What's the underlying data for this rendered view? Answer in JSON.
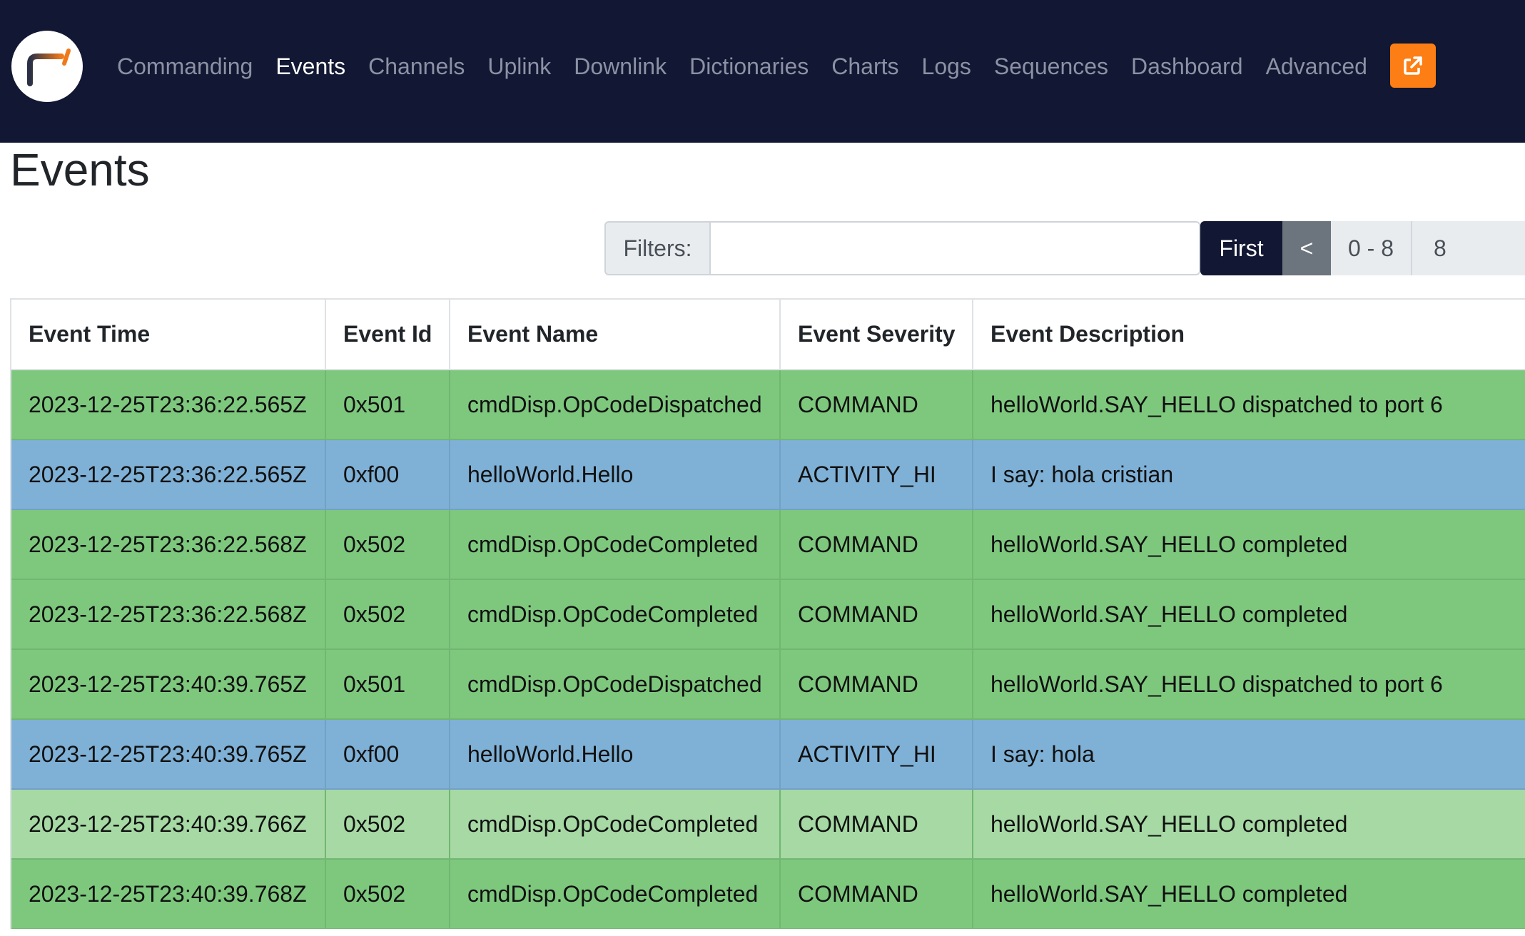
{
  "nav": {
    "items": [
      "Commanding",
      "Events",
      "Channels",
      "Uplink",
      "Downlink",
      "Dictionaries",
      "Charts",
      "Logs",
      "Sequences",
      "Dashboard",
      "Advanced"
    ],
    "active": "Events",
    "external_icon": "external-link-icon"
  },
  "colors": {
    "navbar": "#121733",
    "accent": "#fd7e14",
    "command_row": "#7ec87e",
    "activity_row": "#7fb0d6",
    "hover_row": "#a6d9a4"
  },
  "page": {
    "title": "Events"
  },
  "filter": {
    "label": "Filters:",
    "value": "",
    "placeholder": ""
  },
  "pager": {
    "first": "First",
    "prev": "<",
    "range": "0 - 8",
    "count": "8"
  },
  "table": {
    "headers": [
      "Event Time",
      "Event Id",
      "Event Name",
      "Event Severity",
      "Event Description"
    ],
    "rows": [
      {
        "kind": "command",
        "cells": [
          "2023-12-25T23:36:22.565Z",
          "0x501",
          "cmdDisp.OpCodeDispatched",
          "COMMAND",
          "helloWorld.SAY_HELLO dispatched to port 6"
        ]
      },
      {
        "kind": "activity",
        "cells": [
          "2023-12-25T23:36:22.565Z",
          "0xf00",
          "helloWorld.Hello",
          "ACTIVITY_HI",
          "I say: hola cristian"
        ]
      },
      {
        "kind": "command",
        "cells": [
          "2023-12-25T23:36:22.568Z",
          "0x502",
          "cmdDisp.OpCodeCompleted",
          "COMMAND",
          "helloWorld.SAY_HELLO completed"
        ]
      },
      {
        "kind": "command",
        "cells": [
          "2023-12-25T23:36:22.568Z",
          "0x502",
          "cmdDisp.OpCodeCompleted",
          "COMMAND",
          "helloWorld.SAY_HELLO completed"
        ]
      },
      {
        "kind": "command",
        "cells": [
          "2023-12-25T23:40:39.765Z",
          "0x501",
          "cmdDisp.OpCodeDispatched",
          "COMMAND",
          "helloWorld.SAY_HELLO dispatched to port 6"
        ]
      },
      {
        "kind": "activity",
        "cells": [
          "2023-12-25T23:40:39.765Z",
          "0xf00",
          "helloWorld.Hello",
          "ACTIVITY_HI",
          "I say: hola"
        ]
      },
      {
        "kind": "command hover",
        "cells": [
          "2023-12-25T23:40:39.766Z",
          "0x502",
          "cmdDisp.OpCodeCompleted",
          "COMMAND",
          "helloWorld.SAY_HELLO completed"
        ]
      },
      {
        "kind": "command",
        "cells": [
          "2023-12-25T23:40:39.768Z",
          "0x502",
          "cmdDisp.OpCodeCompleted",
          "COMMAND",
          "helloWorld.SAY_HELLO completed"
        ]
      }
    ]
  }
}
